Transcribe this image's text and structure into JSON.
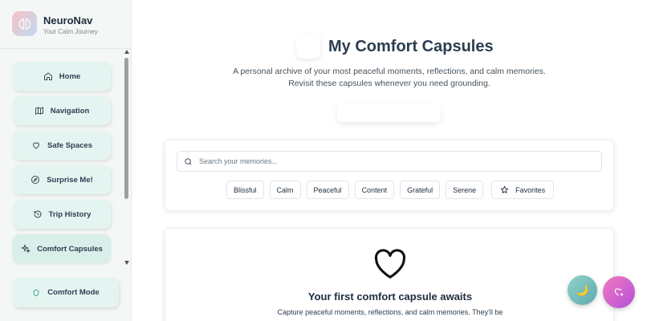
{
  "brand": {
    "name": "NeuroNav",
    "tagline": "Your Calm Journey"
  },
  "sidebar": {
    "items": [
      {
        "label": "Home",
        "icon": "home-icon"
      },
      {
        "label": "Navigation",
        "icon": "map-icon"
      },
      {
        "label": "Safe Spaces",
        "icon": "heart-icon"
      },
      {
        "label": "Surprise Me!",
        "icon": "compass-icon"
      },
      {
        "label": "Trip History",
        "icon": "history-icon"
      },
      {
        "label": "Comfort Capsules",
        "icon": "sparkles-icon"
      }
    ],
    "active": "Comfort Capsules",
    "comfort_mode": {
      "label": "Comfort Mode",
      "icon": "shield-icon"
    }
  },
  "main": {
    "title": "My Comfort Capsules",
    "description": "A personal archive of your most peaceful moments, reflections, and calm memories. Revisit these capsules whenever you need grounding.",
    "search": {
      "placeholder": "Search your memories..."
    },
    "filters": [
      "Blissful",
      "Calm",
      "Peaceful",
      "Content",
      "Grateful",
      "Serene"
    ],
    "favorites_label": "Favorites",
    "empty_state": {
      "title": "Your first comfort capsule awaits",
      "text": "Capture peaceful moments, reflections, and calm memories. They'll be"
    }
  },
  "colors": {
    "accent": "#e4f5f1",
    "fab_moon": "#6fbdb8",
    "fab_heart": "#d266cc"
  }
}
